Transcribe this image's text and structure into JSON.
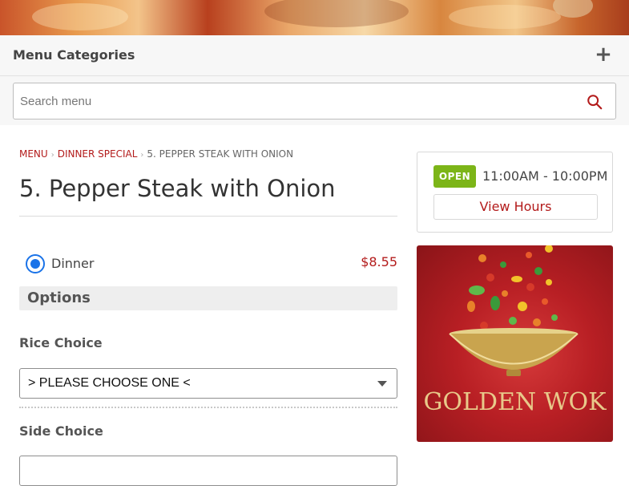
{
  "header": {
    "menu_categories_label": "Menu Categories",
    "expand_symbol": "+"
  },
  "search": {
    "placeholder": "Search menu",
    "value": ""
  },
  "breadcrumb": [
    {
      "label": "MENU",
      "link": true
    },
    {
      "label": "DINNER SPECIAL",
      "link": true
    },
    {
      "label": "5. PEPPER STEAK WITH ONION",
      "link": false
    }
  ],
  "breadcrumb_separator": "›",
  "item": {
    "title": "5. Pepper Steak with Onion",
    "sizes": [
      {
        "label": "Dinner",
        "price": "$8.55",
        "selected": true
      }
    ]
  },
  "options": {
    "heading": "Options",
    "groups": [
      {
        "label": "Rice Choice",
        "selected_value": "> PLEASE CHOOSE ONE <"
      },
      {
        "label": "Side Choice",
        "selected_value": ""
      }
    ]
  },
  "hours": {
    "status": "OPEN",
    "range": "11:00AM - 10:00PM",
    "view_hours_label": "View Hours"
  },
  "logo": {
    "text": "GOLDEN WOK"
  },
  "colors": {
    "accent": "#b31b1b",
    "open_badge": "#7cb518",
    "radio": "#1a73e8",
    "logo_background": "#b81f24",
    "logo_gold": "#e8c98a"
  }
}
